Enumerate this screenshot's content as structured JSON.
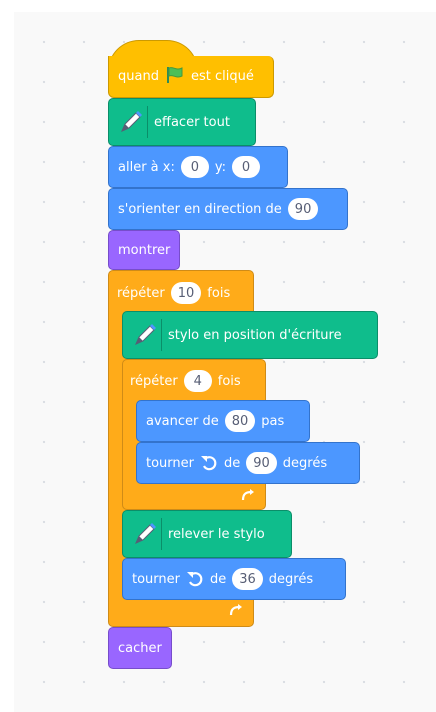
{
  "script": {
    "when_flag": {
      "before": "quand",
      "after": "est cliqué"
    },
    "clear": {
      "label": "effacer tout"
    },
    "goto": {
      "label": "aller à x:",
      "x": "0",
      "y_label": "y:",
      "y": "0"
    },
    "point": {
      "label": "s'orienter en direction de",
      "value": "90"
    },
    "show": {
      "label": "montrer"
    },
    "repeat_outer": {
      "label": "répéter",
      "times": "10",
      "suffix": "fois"
    },
    "pen_down": {
      "label": "stylo en position d'écriture"
    },
    "repeat_inner": {
      "label": "répéter",
      "times": "4",
      "suffix": "fois"
    },
    "move": {
      "label": "avancer de",
      "value": "80",
      "suffix": "pas"
    },
    "turn_inner": {
      "label": "tourner",
      "de": "de",
      "value": "90",
      "suffix": "degrés"
    },
    "pen_up": {
      "label": "relever le stylo"
    },
    "turn_outer": {
      "label": "tourner",
      "de": "de",
      "value": "36",
      "suffix": "degrés"
    },
    "hide": {
      "label": "cacher"
    }
  },
  "colors": {
    "events": "#ffbf00",
    "control": "#ffab19",
    "motion": "#4c97ff",
    "looks": "#9966ff",
    "pen": "#0fbd8c"
  },
  "icons": [
    "green-flag-icon",
    "pen-extension-icon",
    "rotate-left-icon",
    "loop-arrow-icon"
  ]
}
